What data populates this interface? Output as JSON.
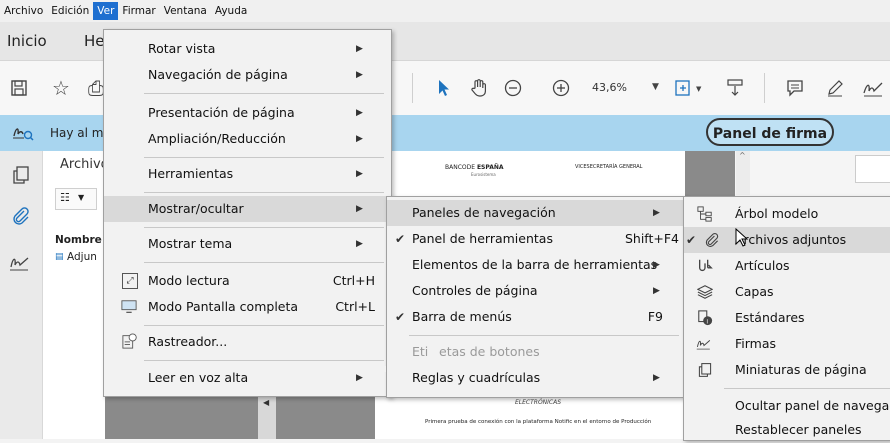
{
  "menubar": {
    "items": [
      "Archivo",
      "Edición",
      "Ver",
      "Firmar",
      "Ventana",
      "Ayuda"
    ],
    "active_index": 2
  },
  "tabs": {
    "home": "Inicio",
    "tools_partial": "He"
  },
  "toolbar": {
    "zoom": "43,6%"
  },
  "notice": {
    "text_partial": "Hay al m",
    "panel_firma": "Panel de firma"
  },
  "nav": {
    "archivos_partial": "Archivo",
    "nombre": "Nombre",
    "adjun_partial": "Adjun"
  },
  "doc": {
    "header_left_a": "BANCODE ",
    "header_left_b": "ESPAÑA",
    "header_left_sub": "Eurosistema",
    "header_right": "VICESECRETARÍA GENERAL",
    "line1": "ELECTRÓNICAS",
    "line2": "Primera prueba de conexión con la plataforma Notific en el entorno de Producción"
  },
  "ver_menu": {
    "items": [
      {
        "label": "Rotar vista",
        "arrow": true
      },
      {
        "label": "Navegación de página",
        "arrow": true
      },
      {
        "label": "Presentación de página",
        "arrow": true
      },
      {
        "label": "Ampliación/Reducción",
        "arrow": true
      },
      {
        "label": "Herramientas",
        "arrow": true
      },
      {
        "label": "Mostrar/ocultar",
        "arrow": true
      },
      {
        "label": "Mostrar tema",
        "arrow": true
      },
      {
        "label": "Modo lectura",
        "shortcut": "Ctrl+H"
      },
      {
        "label": "Modo Pantalla completa",
        "shortcut": "Ctrl+L"
      },
      {
        "label": "Rastreador..."
      },
      {
        "label": "Leer en voz alta",
        "arrow": true
      }
    ]
  },
  "mostrar_menu": {
    "items": [
      {
        "label": "Paneles de navegación",
        "arrow": true
      },
      {
        "label": "Panel de herramientas",
        "shortcut": "Shift+F4",
        "checked": true
      },
      {
        "label": "Elementos de la barra de herramientas",
        "arrow": true
      },
      {
        "label": "Controles de página",
        "arrow": true
      },
      {
        "label": "Barra de menús",
        "shortcut": "F9",
        "checked": true
      },
      {
        "label_a": "Eti",
        "label_b": "etas de botones"
      },
      {
        "label": "Reglas y cuadrículas",
        "arrow": true
      }
    ]
  },
  "paneles_menu": {
    "items": [
      {
        "label": "Árbol modelo",
        "icon": "tree-icon"
      },
      {
        "label": "Archivos adjuntos",
        "icon": "paperclip-icon",
        "checked": true
      },
      {
        "label": "Artículos",
        "icon": "articles-icon"
      },
      {
        "label": "Capas",
        "icon": "layers-icon"
      },
      {
        "label": "Estándares",
        "icon": "standards-icon"
      },
      {
        "label": "Firmas",
        "icon": "signature-icon"
      },
      {
        "label": "Miniaturas de página",
        "icon": "thumbnails-icon"
      },
      {
        "label": "Ocultar panel de navegació"
      },
      {
        "label": "Restablecer paneles"
      }
    ]
  },
  "colors": {
    "accent": "#1e6fd0",
    "notice": "#a8d5ef",
    "toolbar_blue": "#1e73be"
  }
}
